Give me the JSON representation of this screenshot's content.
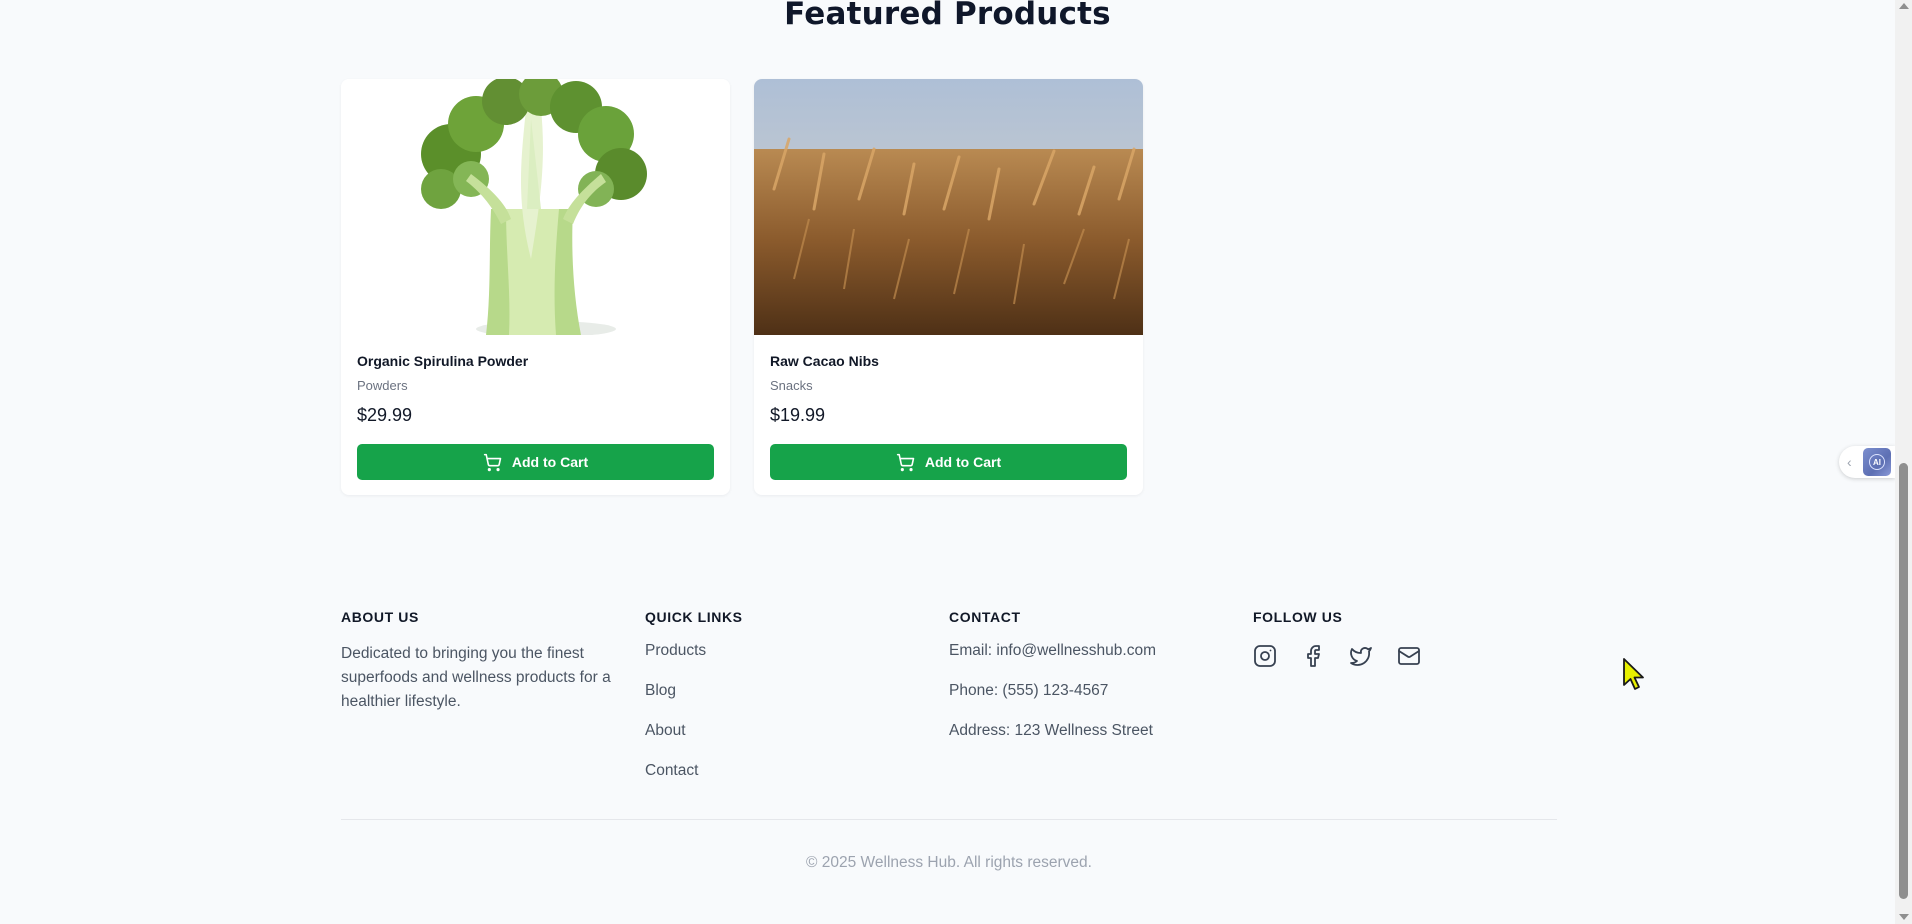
{
  "featured": {
    "title": "Featured Products",
    "products": [
      {
        "name": "Organic Spirulina Powder",
        "category": "Powders",
        "price": "$29.99",
        "button": "Add to Cart",
        "image": "broccoli"
      },
      {
        "name": "Raw Cacao Nibs",
        "category": "Snacks",
        "price": "$19.99",
        "button": "Add to Cart",
        "image": "wheat field"
      }
    ]
  },
  "footer": {
    "about": {
      "heading": "ABOUT US",
      "text": "Dedicated to bringing you the finest superfoods and wellness products for a healthier lifestyle."
    },
    "quick_links": {
      "heading": "QUICK LINKS",
      "items": [
        "Products",
        "Blog",
        "About",
        "Contact"
      ]
    },
    "contact": {
      "heading": "CONTACT",
      "email": "Email: info@wellnesshub.com",
      "phone": "Phone: (555) 123-4567",
      "address": "Address: 123 Wellness Street"
    },
    "follow": {
      "heading": "FOLLOW US",
      "icons": [
        "instagram-icon",
        "facebook-icon",
        "twitter-icon",
        "mail-icon"
      ]
    },
    "copyright": "© 2025 Wellness Hub. All rights reserved."
  },
  "ai_widget": {
    "label": "AI"
  },
  "colors": {
    "primary_button": "#16a34a",
    "heading": "#0f172a",
    "muted_text": "#4b5563",
    "page_bg": "#f8fafc"
  }
}
